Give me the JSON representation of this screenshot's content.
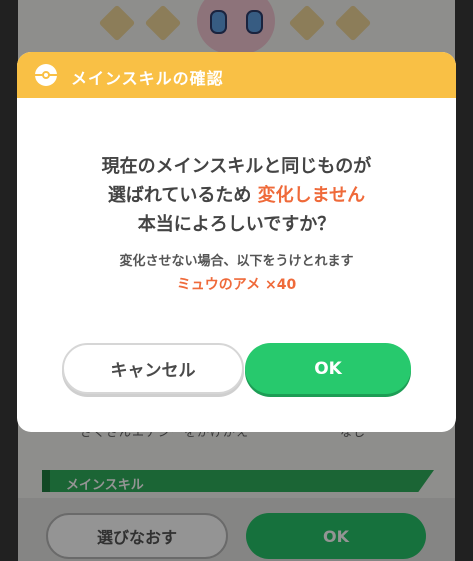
{
  "dialog": {
    "title": "メインスキルの確認",
    "message_line1": "現在のメインスキルと同じものが",
    "message_line2_prefix": "選ばれているため ",
    "message_line2_highlight": "変化しません",
    "message_line3": "本当によろしいですか？",
    "sub_line1": "変化させない場合、以下をうけとれます",
    "sub_line2": "ミュウのアメ ×40",
    "cancel_label": "キャンセル",
    "ok_label": "OK"
  },
  "background": {
    "section_label": "メインスキル",
    "redo_label": "選びなおす",
    "ok_label": "OK",
    "hidden_row_left": "さくさんエナジーをかけがえ",
    "hidden_row_right": "なし"
  },
  "colors": {
    "header": "#f9c045",
    "highlight": "#ef6a3a",
    "ok_button": "#27c96d"
  },
  "icons": {
    "header_icon": "pokeball-icon"
  }
}
